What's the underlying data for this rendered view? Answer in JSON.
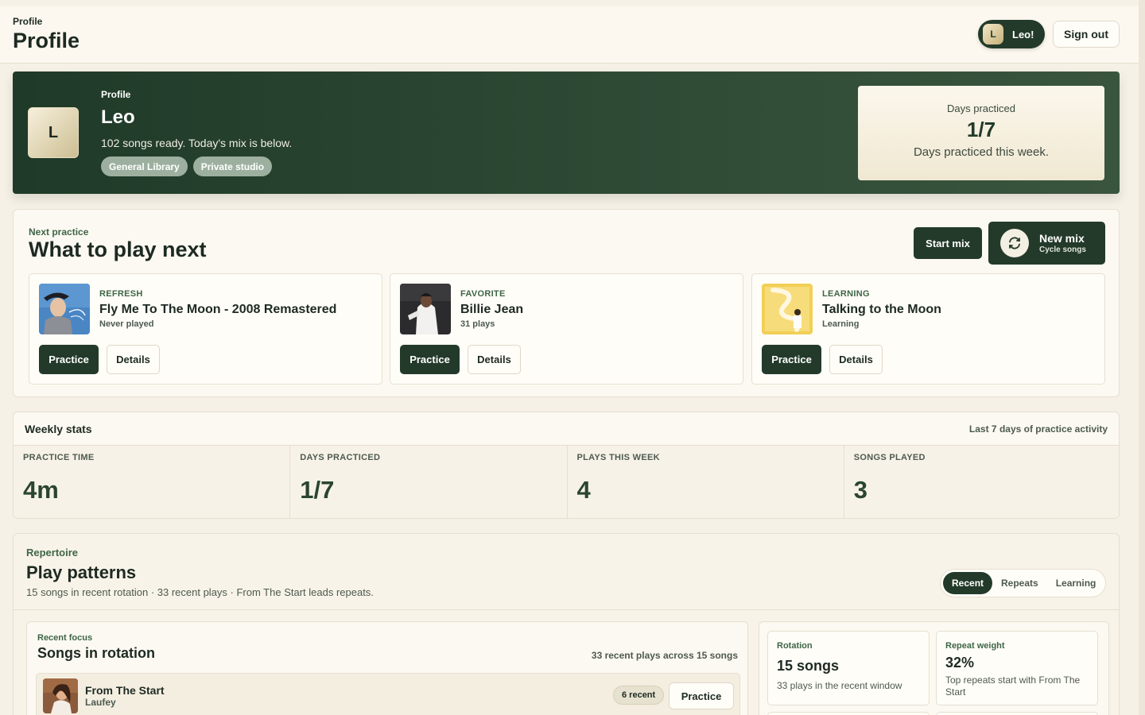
{
  "header": {
    "breadcrumb": "Profile",
    "title": "Profile",
    "user_initial": "L",
    "user_name": "Leo!",
    "sign_out": "Sign out"
  },
  "hero": {
    "kicker": "Profile",
    "initial": "L",
    "name": "Leo",
    "subtitle": "102 songs ready. Today's mix is below.",
    "chips": [
      "General Library",
      "Private studio"
    ],
    "card": {
      "label": "Days practiced",
      "value": "1/7",
      "caption": "Days practiced this week."
    }
  },
  "next": {
    "kicker": "Next practice",
    "title": "What to play next",
    "start_mix": "Start mix",
    "new_mix": {
      "title": "New mix",
      "subtitle": "Cycle songs",
      "icon": "refresh-icon"
    },
    "songs": [
      {
        "tag": "REFRESH",
        "title": "Fly Me To The Moon - 2008 Remastered",
        "meta": "Never played",
        "practice": "Practice",
        "details": "Details"
      },
      {
        "tag": "FAVORITE",
        "title": "Billie Jean",
        "meta": "31 plays",
        "practice": "Practice",
        "details": "Details"
      },
      {
        "tag": "LEARNING",
        "title": "Talking to the Moon",
        "meta": "Learning",
        "practice": "Practice",
        "details": "Details"
      }
    ]
  },
  "weekly": {
    "title": "Weekly stats",
    "note": "Last 7 days of practice activity",
    "stats": [
      {
        "label": "PRACTICE TIME",
        "value": "4m"
      },
      {
        "label": "DAYS PRACTICED",
        "value": "1/7"
      },
      {
        "label": "PLAYS THIS WEEK",
        "value": "4"
      },
      {
        "label": "SONGS PLAYED",
        "value": "3"
      }
    ]
  },
  "repertoire": {
    "kicker": "Repertoire",
    "title": "Play patterns",
    "subtitle": "15 songs in recent rotation · 33 recent plays · From The Start leads repeats.",
    "tabs": [
      "Recent",
      "Repeats",
      "Learning"
    ],
    "rotation": {
      "kicker": "Recent focus",
      "title": "Songs in rotation",
      "note": "33 recent plays across 15 songs",
      "items": [
        {
          "title": "From The Start",
          "artist": "Laufey",
          "badge": "6 recent",
          "practice": "Practice"
        }
      ]
    },
    "side": [
      {
        "label": "Rotation",
        "value": "15 songs",
        "caption": "33 plays in the recent window"
      },
      {
        "label": "Repeat weight",
        "value": "32%",
        "caption": "Top repeats start with From The Start"
      }
    ]
  },
  "colors": {
    "accent_dark": "#233a2a",
    "accent_green": "#3e6546",
    "background": "#f6f1e6"
  }
}
